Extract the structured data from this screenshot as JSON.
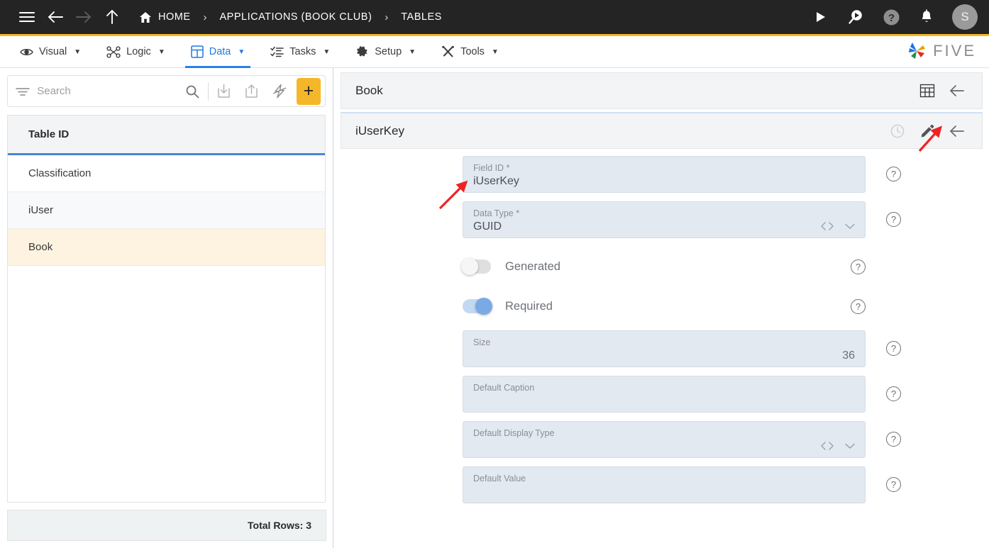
{
  "topbar": {
    "menu_icon": "hamburger-icon",
    "back_icon": "arrow-left-icon",
    "forward_icon": "arrow-right-icon",
    "up_icon": "arrow-up-icon",
    "breadcrumb": [
      {
        "label": "HOME",
        "icon": "home-icon"
      },
      {
        "label": "APPLICATIONS (BOOK CLUB)",
        "icon": ""
      },
      {
        "label": "TABLES",
        "icon": ""
      }
    ],
    "separator": "›",
    "actions": [
      {
        "name": "run-icon",
        "title": "Run"
      },
      {
        "name": "search-run-icon",
        "title": "Search"
      },
      {
        "name": "help-icon",
        "title": "Help"
      },
      {
        "name": "bell-icon",
        "title": "Notifications"
      }
    ],
    "avatar_initial": "S"
  },
  "menubar": {
    "items": [
      {
        "label": "Visual",
        "icon": "eye-icon",
        "caret": "▼",
        "active": false
      },
      {
        "label": "Logic",
        "icon": "logic-nodes-icon",
        "caret": "▼",
        "active": false
      },
      {
        "label": "Data",
        "icon": "grid-icon",
        "caret": "▼",
        "active": true
      },
      {
        "label": "Tasks",
        "icon": "task-list-icon",
        "caret": "▼",
        "active": false
      },
      {
        "label": "Setup",
        "icon": "gear-icon",
        "caret": "▼",
        "active": false
      },
      {
        "label": "Tools",
        "icon": "tools-icon",
        "caret": "▼",
        "active": false
      }
    ],
    "brand": "FIVE"
  },
  "sidebar": {
    "search": {
      "placeholder": "Search",
      "value": ""
    },
    "toolbar": [
      {
        "name": "filter-icon"
      },
      {
        "name": "search-icon"
      },
      {
        "name": "import-icon"
      },
      {
        "name": "export-icon"
      },
      {
        "name": "lightning-icon"
      },
      {
        "name": "add-button",
        "label": "+"
      }
    ],
    "table": {
      "column_header": "Table ID",
      "rows": [
        {
          "label": "Classification",
          "selected": false
        },
        {
          "label": "iUser",
          "selected": false
        },
        {
          "label": "Book",
          "selected": true
        }
      ]
    },
    "footer": "Total Rows: 3"
  },
  "main": {
    "panel_title": "Book",
    "panel_icons": [
      {
        "name": "grid-table-icon"
      },
      {
        "name": "back-arrow-icon"
      }
    ],
    "record_title": "iUserKey",
    "record_icons": [
      {
        "name": "history-clock-icon"
      },
      {
        "name": "edit-pencil-icon"
      },
      {
        "name": "back-arrow-icon"
      }
    ],
    "fields": [
      {
        "label": "Field ID *",
        "value": "iUserKey",
        "type": "text",
        "align": "left",
        "help": "?"
      },
      {
        "label": "Data Type *",
        "value": "GUID",
        "type": "select",
        "align": "left",
        "help": "?"
      },
      {
        "label": "Generated",
        "value": "",
        "type": "toggle",
        "state": "off",
        "help": "?"
      },
      {
        "label": "Required",
        "value": "",
        "type": "toggle",
        "state": "on",
        "help": "?"
      },
      {
        "label": "Size",
        "value": "36",
        "type": "number",
        "align": "right",
        "help": "?"
      },
      {
        "label": "Default Caption",
        "value": "",
        "type": "text",
        "align": "left",
        "help": "?"
      },
      {
        "label": "Default Display Type",
        "value": "",
        "type": "select",
        "align": "left",
        "help": "?"
      },
      {
        "label": "Default Value",
        "value": "",
        "type": "text",
        "align": "left",
        "help": "?"
      }
    ]
  },
  "annotations": {
    "arrow_color": "#ee2222",
    "arrows": [
      {
        "name": "arrow-to-edit-pencil",
        "target": "edit-pencil-icon"
      },
      {
        "name": "arrow-to-field-id",
        "target": "field-id-input"
      }
    ]
  },
  "colors": {
    "topbar_bg": "#242424",
    "accent_yellow": "#F5B722",
    "accent_blue": "#2f80e5",
    "selected_row": "#FDF3E0",
    "field_bg": "#E2E9F1"
  }
}
